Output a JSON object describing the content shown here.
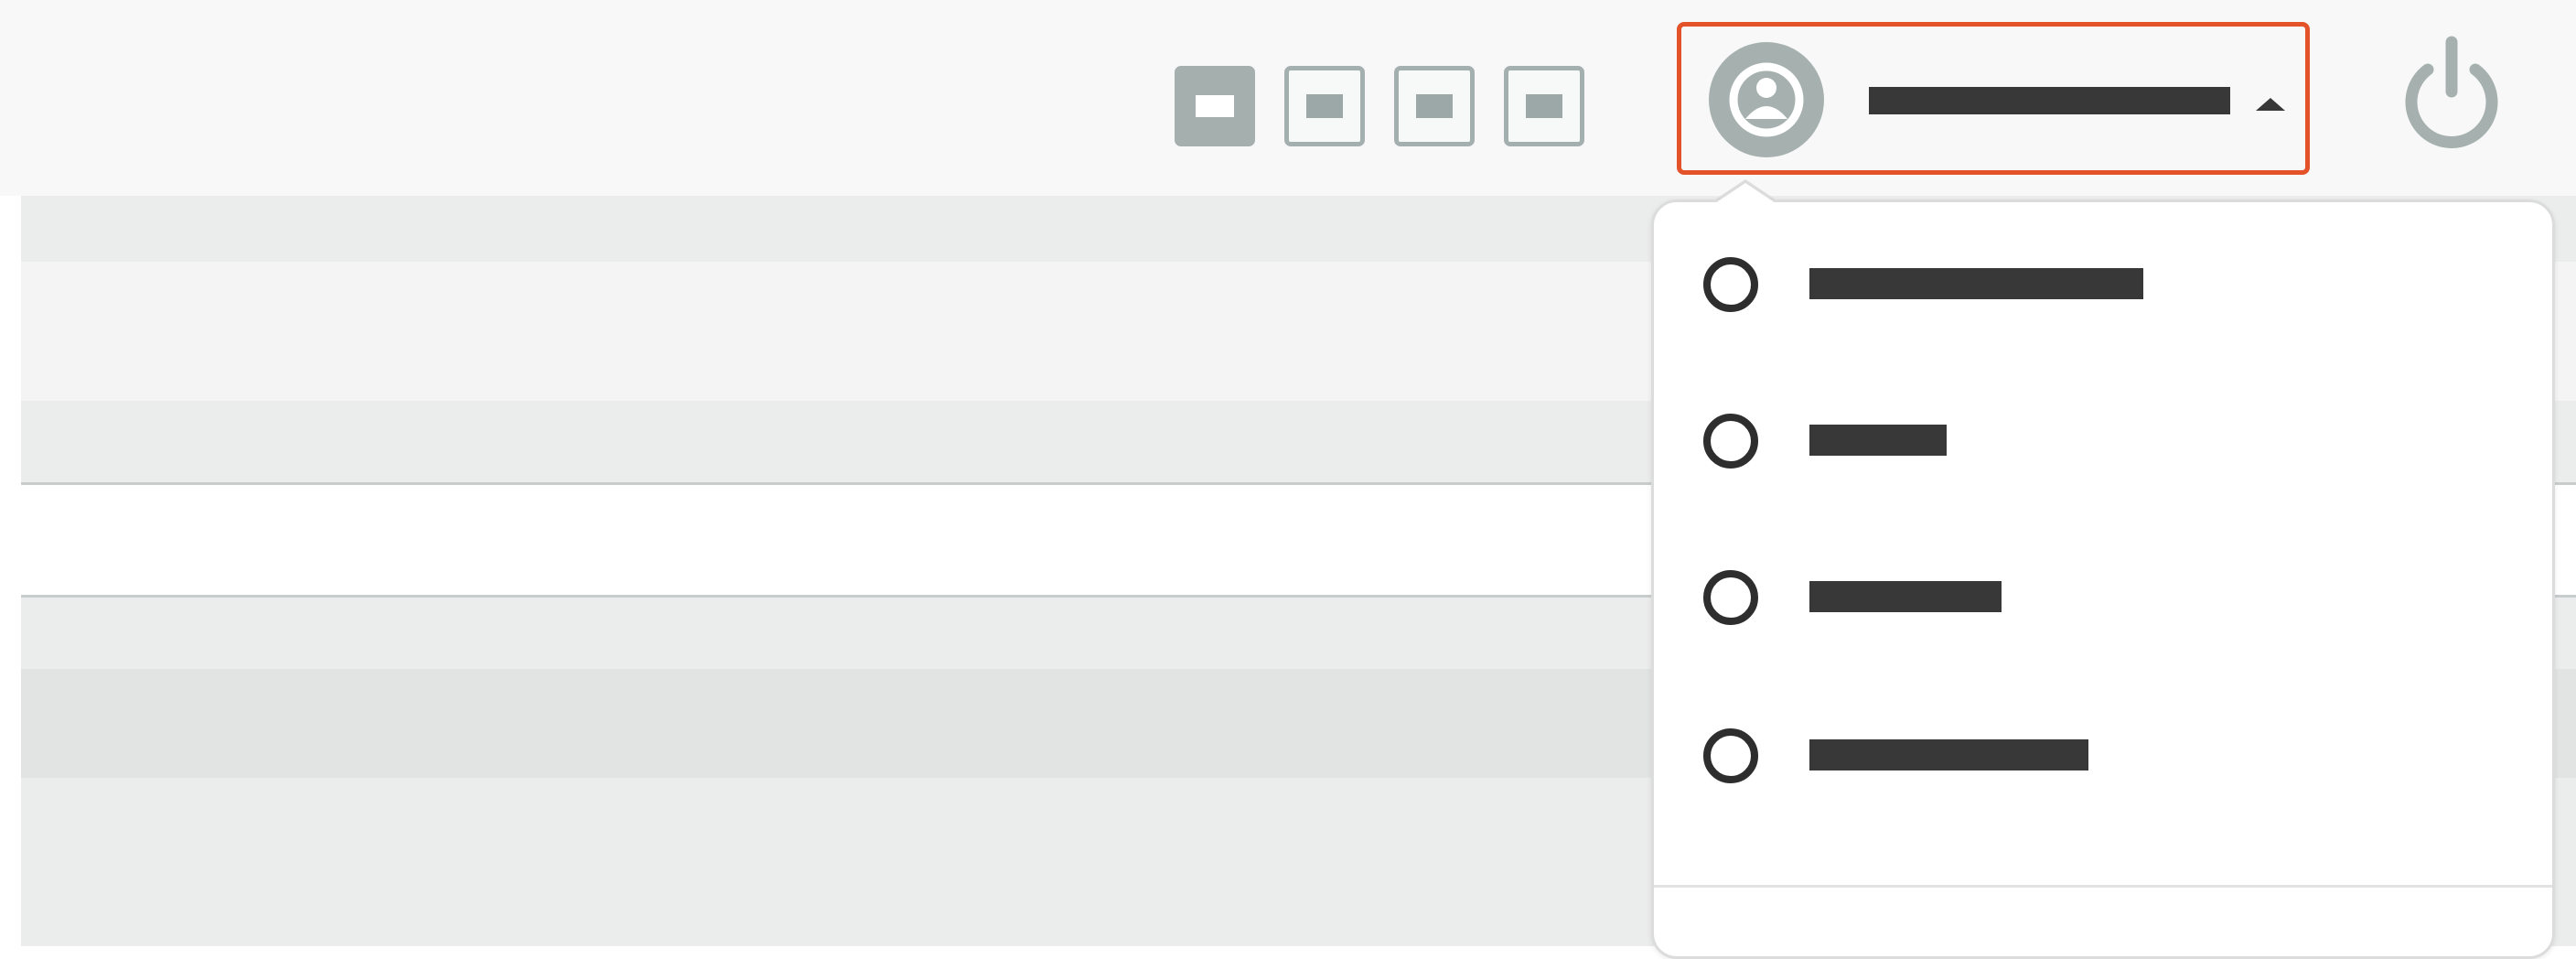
{
  "user_menu": {
    "user_name": ""
  },
  "layout_buttons": [
    {
      "name": "layout-single",
      "active": true
    },
    {
      "name": "layout-option-2",
      "active": false
    },
    {
      "name": "layout-option-3",
      "active": false
    },
    {
      "name": "layout-option-4",
      "active": false
    }
  ],
  "dropdown": {
    "items": [
      {
        "label": "",
        "selected": false
      },
      {
        "label": "",
        "selected": false
      },
      {
        "label": "",
        "selected": false
      },
      {
        "label": "",
        "selected": false
      }
    ]
  },
  "icons": {
    "avatar": "user-circle-icon",
    "caret": "caret-up-icon",
    "power": "power-icon",
    "radio": "radio-unchecked-icon"
  },
  "colors": {
    "highlight_border": "#e4522a",
    "icon_gray": "#a6b1af",
    "text_dark": "#383838",
    "topbar_bg": "#f8f8f8"
  }
}
